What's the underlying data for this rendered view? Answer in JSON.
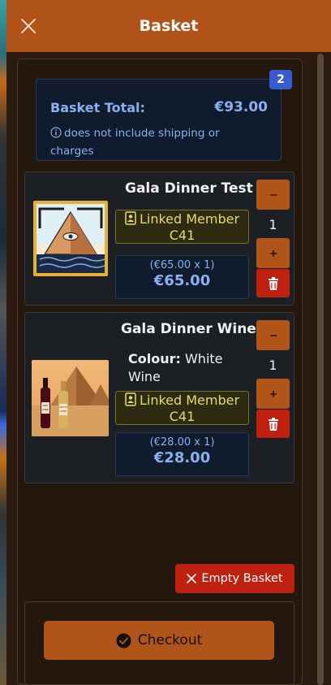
{
  "header": {
    "title": "Basket"
  },
  "basket": {
    "count_badge": "2",
    "total_label": "Basket Total:",
    "total_value": "€93.00",
    "note": "does not include shipping or charges"
  },
  "items": [
    {
      "name": "Gala Dinner Test",
      "linked_line1": "Linked Member",
      "linked_line2": "C41",
      "unit_price": "(€65.00 x 1)",
      "total": "€65.00",
      "quantity": "1",
      "image_icon": "pyramid-eye-poster"
    },
    {
      "name": "Gala Dinner Wine",
      "colour_label": "Colour:",
      "colour_value": "White Wine",
      "linked_line1": "Linked Member",
      "linked_line2": "C41",
      "unit_price": "(€28.00 x 1)",
      "total": "€28.00",
      "quantity": "1",
      "image_icon": "wine-bottles-pyramid-photo",
      "bottle_labels": [
        "RED WINE",
        "WHITE WINE"
      ]
    }
  ],
  "actions": {
    "empty_label": "Empty Basket",
    "checkout_label": "Checkout"
  },
  "colors": {
    "accent": "#b0541a",
    "danger": "#c02010",
    "info_bg": "#111b2e",
    "info_text": "#8ab0f0",
    "linked_text": "#e8da6a",
    "badge": "#3a5ad0"
  }
}
